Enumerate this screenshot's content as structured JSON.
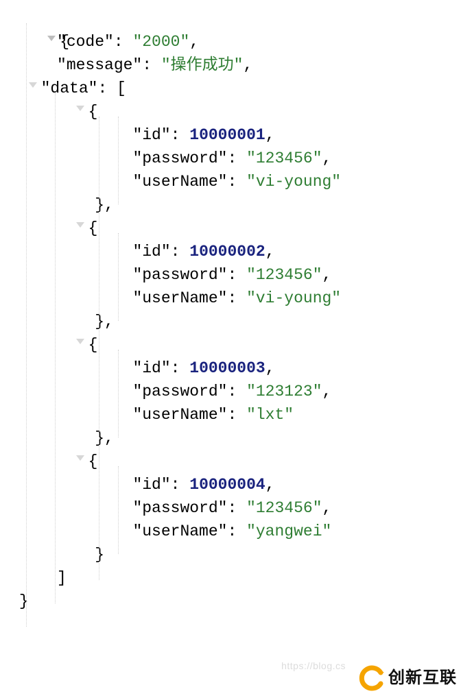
{
  "json": {
    "code_key": "\"code\"",
    "code_val": "\"2000\"",
    "message_key": "\"message\"",
    "message_val": "\"操作成功\"",
    "data_key": "\"data\"",
    "items": [
      {
        "id_key": "\"id\"",
        "id_val": "10000001",
        "password_key": "\"password\"",
        "password_val": "\"123456\"",
        "userName_key": "\"userName\"",
        "userName_val": "\"vi-young\""
      },
      {
        "id_key": "\"id\"",
        "id_val": "10000002",
        "password_key": "\"password\"",
        "password_val": "\"123456\"",
        "userName_key": "\"userName\"",
        "userName_val": "\"vi-young\""
      },
      {
        "id_key": "\"id\"",
        "id_val": "10000003",
        "password_key": "\"password\"",
        "password_val": "\"123123\"",
        "userName_key": "\"userName\"",
        "userName_val": "\"lxt\""
      },
      {
        "id_key": "\"id\"",
        "id_val": "10000004",
        "password_key": "\"password\"",
        "password_val": "\"123456\"",
        "userName_key": "\"userName\"",
        "userName_val": "\"yangwei\""
      }
    ]
  },
  "watermark": {
    "url": "https://blog.cs",
    "brand": "创新互联"
  }
}
